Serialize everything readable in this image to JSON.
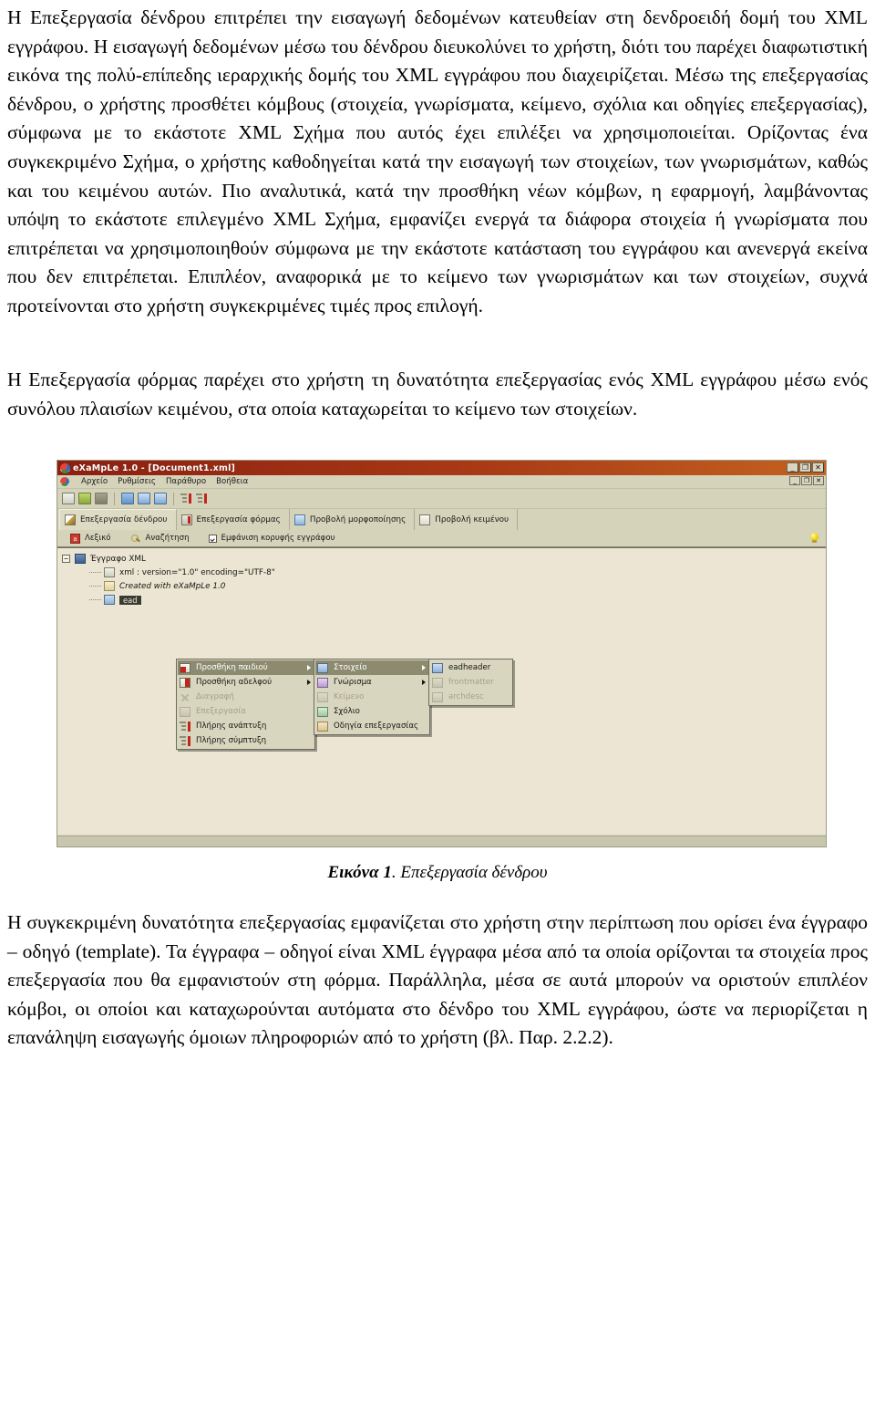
{
  "document": {
    "paragraphs": [
      "Η Επεξεργασία δένδρου επιτρέπει την εισαγωγή δεδομένων κατευθείαν στη δενδροειδή δομή του XML εγγράφου. Η εισαγωγή δεδομένων μέσω του δένδρου διευκολύνει το χρήστη, διότι του παρέχει διαφωτιστική εικόνα της πολύ-επίπεδης ιεραρχικής δομής του XML εγγράφου που διαχειρίζεται. Μέσω της επεξεργασίας δένδρου, ο χρήστης προσθέτει κόμβους (στοιχεία, γνωρίσματα, κείμενο, σχόλια και οδηγίες επεξεργασίας), σύμφωνα με το εκάστοτε XML Σχήμα που αυτός έχει επιλέξει να χρησιμοποιείται. Ορίζοντας ένα συγκεκριμένο Σχήμα, ο χρήστης καθοδηγείται κατά την εισαγωγή των στοιχείων, των γνωρισμάτων, καθώς και του κειμένου αυτών. Πιο αναλυτικά, κατά την προσθήκη νέων κόμβων, η εφαρμογή, λαμβάνοντας υπόψη το εκάστοτε επιλεγμένο XML Σχήμα, εμφανίζει ενεργά τα διάφορα στοιχεία ή γνωρίσματα που επιτρέπεται να χρησιμοποιηθούν σύμφωνα με την εκάστοτε κατάσταση του εγγράφου και ανενεργά εκείνα που δεν επιτρέπεται. Επιπλέον, αναφορικά με το κείμενο των γνωρισμάτων και των στοιχείων, συχνά προτείνονται στο χρήστη συγκεκριμένες τιμές προς επιλογή.",
      "Η Επεξεργασία φόρμας παρέχει στο χρήστη τη δυνατότητα επεξεργασίας ενός XML εγγράφου μέσω ενός συνόλου πλαισίων κειμένου, στα οποία καταχωρείται το κείμενο των στοιχείων.",
      "Η συγκεκριμένη δυνατότητα επεξεργασίας εμφανίζεται στο χρήστη στην περίπτωση που ορίσει ένα έγγραφο – οδηγό (template). Τα έγγραφα – οδηγοί είναι XML έγγραφα μέσα από τα οποία ορίζονται τα στοιχεία προς επεξεργασία που θα εμφανιστούν στη φόρμα. Παράλληλα, μέσα σε αυτά μπορούν να οριστούν επιπλέον κόμβοι, οι οποίοι και καταχωρούνται αυτόματα στο δένδρο του XML εγγράφου, ώστε να περιορίζεται η επανάληψη εισαγωγής όμοιων πληροφοριών από το χρήστη (βλ. Παρ. 2.2.2)."
    ],
    "figure_caption": {
      "label": "Εικόνα 1",
      "text": ". Επεξεργασία δένδρου"
    }
  },
  "app": {
    "titlebar": {
      "title": "eXaMpLe 1.0 - [Document1.xml]",
      "minimize": "_",
      "restore": "❐",
      "close": "✕"
    },
    "mdi_buttons": {
      "minimize": "_",
      "restore": "❐",
      "close": "✕"
    },
    "menu": [
      {
        "label": "Αρχείο"
      },
      {
        "label": "Ρυθμίσεις"
      },
      {
        "label": "Παράθυρο"
      },
      {
        "label": "Βοήθεια"
      }
    ],
    "toolbar_icons": [
      {
        "name": "new-document-icon"
      },
      {
        "name": "open-document-icon"
      },
      {
        "name": "save-document-icon"
      },
      {
        "name": "cascade-windows-icon"
      },
      {
        "name": "tile-horizontal-icon"
      },
      {
        "name": "tile-vertical-icon"
      },
      {
        "name": "expand-all-icon"
      },
      {
        "name": "collapse-all-icon"
      }
    ],
    "tabs": [
      {
        "label": "Επεξεργασία δένδρου",
        "selected": true
      },
      {
        "label": "Επεξεργασία φόρμας",
        "selected": false
      },
      {
        "label": "Προβολή μορφοποίησης",
        "selected": false
      },
      {
        "label": "Προβολή κειμένου",
        "selected": false
      }
    ],
    "subbar": {
      "dictionary": "Λεξικό",
      "search": "Αναζήτηση",
      "checkbox_label": "Εμφάνιση κορυφής εγγράφου",
      "checkbox_checked": true,
      "hint_icon": "lightbulb-icon"
    },
    "tree": {
      "root": {
        "label": "Έγγραφο XML",
        "expander": "−"
      },
      "children": [
        {
          "label": "xml : version=\"1.0\" encoding=\"UTF-8\"",
          "type": "processing-instruction"
        },
        {
          "label": "Created with eXaMpLe 1.0",
          "type": "comment",
          "italic": true
        },
        {
          "label": "ead",
          "type": "element",
          "selected": true
        }
      ]
    },
    "context_menu_level1": [
      {
        "label": "Προσθήκη παιδιού",
        "icon": "add-child-icon",
        "submenu": true,
        "highlighted": true,
        "disabled": false
      },
      {
        "label": "Προσθήκη αδελφού",
        "icon": "add-sibling-icon",
        "submenu": true,
        "highlighted": false,
        "disabled": false
      },
      {
        "label": "Διαγραφή",
        "icon": "delete-icon",
        "submenu": false,
        "highlighted": false,
        "disabled": true
      },
      {
        "label": "Επεξεργασία",
        "icon": "edit-icon",
        "submenu": false,
        "highlighted": false,
        "disabled": true
      },
      {
        "label": "Πλήρης ανάπτυξη",
        "icon": "expand-all-icon",
        "submenu": false,
        "highlighted": false,
        "disabled": false
      },
      {
        "label": "Πλήρης σύμπτυξη",
        "icon": "collapse-all-icon",
        "submenu": false,
        "highlighted": false,
        "disabled": false
      }
    ],
    "context_menu_level2": [
      {
        "label": "Στοιχείο",
        "icon": "element-node-icon",
        "submenu": true,
        "highlighted": true,
        "disabled": false
      },
      {
        "label": "Γνώρισμα",
        "icon": "attribute-node-icon",
        "submenu": true,
        "highlighted": false,
        "disabled": false
      },
      {
        "label": "Κείμενο",
        "icon": "text-node-icon",
        "submenu": false,
        "highlighted": false,
        "disabled": true
      },
      {
        "label": "Σχόλιο",
        "icon": "comment-node-icon",
        "submenu": false,
        "highlighted": false,
        "disabled": false
      },
      {
        "label": "Οδηγία επεξεργασίας",
        "icon": "processing-instruction-icon",
        "submenu": false,
        "highlighted": false,
        "disabled": false
      }
    ],
    "context_menu_level3": [
      {
        "label": "eadheader",
        "icon": "element-node-icon",
        "disabled": false
      },
      {
        "label": "frontmatter",
        "icon": "element-node-icon",
        "disabled": true
      },
      {
        "label": "archdesc",
        "icon": "element-node-icon",
        "disabled": true
      }
    ],
    "colors": {
      "titlebar_start": "#8c1f10",
      "titlebar_end": "#c4621f",
      "window_face": "#d6d3bb",
      "tree_background": "#ece5d4",
      "menu_highlight": "#8d8b6f",
      "accent_red": "#c0271c",
      "disabled_text": "#a3a08b"
    }
  }
}
